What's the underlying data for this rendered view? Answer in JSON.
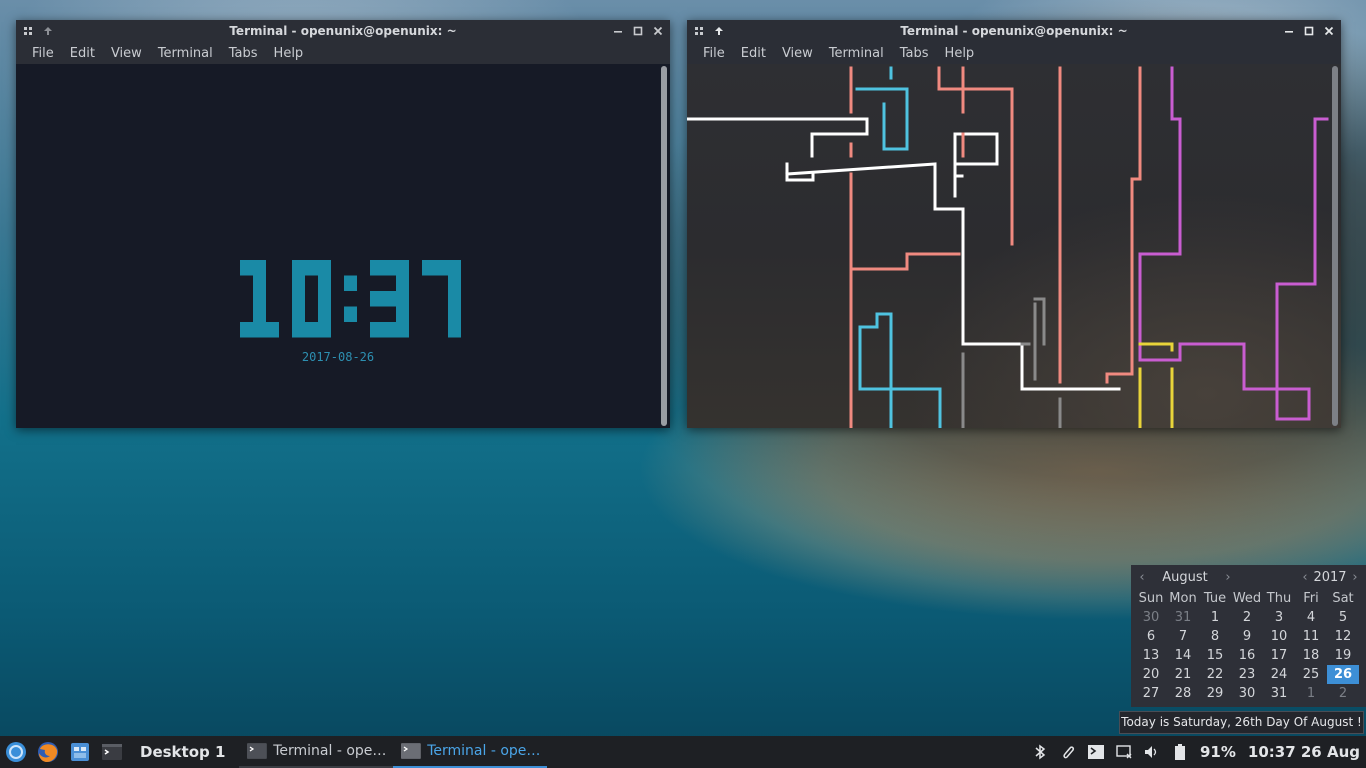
{
  "terminal_left": {
    "title": "Terminal - openunix@openunix: ~",
    "menu": [
      "File",
      "Edit",
      "View",
      "Terminal",
      "Tabs",
      "Help"
    ],
    "clock": "10:37",
    "date": "2017-08-26",
    "clock_color": "#1a8aa6"
  },
  "terminal_right": {
    "title": "Terminal - openunix@openunix: ~",
    "menu": [
      "File",
      "Edit",
      "View",
      "Terminal",
      "Tabs",
      "Help"
    ],
    "pipe_colors": [
      "#ffffff",
      "#f08a80",
      "#4fc3e0",
      "#c95dd1",
      "#e8d43a",
      "#8a8a8a"
    ]
  },
  "calendar": {
    "month": "August",
    "year": "2017",
    "prev_icon": "chevron-left-icon",
    "next_icon": "chevron-right-icon",
    "weekdays": [
      "Sun",
      "Mon",
      "Tue",
      "Wed",
      "Thu",
      "Fri",
      "Sat"
    ],
    "days": [
      [
        "30",
        "31",
        "1",
        "2",
        "3",
        "4",
        "5"
      ],
      [
        "6",
        "7",
        "8",
        "9",
        "10",
        "11",
        "12"
      ],
      [
        "13",
        "14",
        "15",
        "16",
        "17",
        "18",
        "19"
      ],
      [
        "20",
        "21",
        "22",
        "23",
        "24",
        "25",
        "26"
      ],
      [
        "27",
        "28",
        "29",
        "30",
        "31",
        "1",
        "2"
      ]
    ],
    "today": "26",
    "accent": "#3d8fd6"
  },
  "tooltip": "Today is Saturday, 26th Day Of August !",
  "taskbar": {
    "desktop": "Desktop 1",
    "tasks": [
      {
        "label": "Terminal - ope…",
        "active": false
      },
      {
        "label": "Terminal - ope…",
        "active": true
      }
    ],
    "battery": "91%",
    "clock": "10:37 26 Aug",
    "tray_icons": [
      "bluetooth-icon",
      "clipboard-icon",
      "terminal-icon",
      "screen-icon",
      "volume-icon",
      "battery-icon"
    ]
  }
}
